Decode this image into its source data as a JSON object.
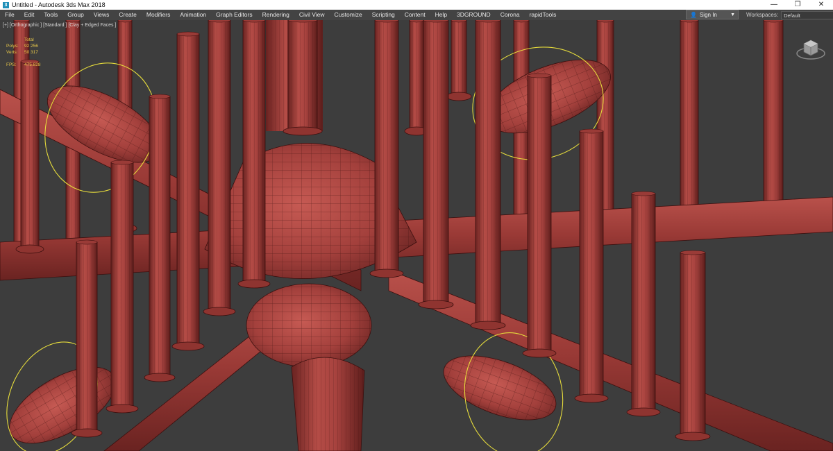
{
  "window": {
    "title": "Untitled - Autodesk 3ds Max 2018",
    "controls": [
      "—",
      "❐",
      "✕"
    ]
  },
  "menu": [
    "File",
    "Edit",
    "Tools",
    "Group",
    "Views",
    "Create",
    "Modifiers",
    "Animation",
    "Graph Editors",
    "Rendering",
    "Civil View",
    "Customize",
    "Scripting",
    "Content",
    "Help",
    "3DGROUND",
    "Corona",
    "rapidTools"
  ],
  "signin": {
    "label": "Sign In"
  },
  "workspaces": {
    "label": "Workspaces:",
    "value": "Default"
  },
  "viewport": {
    "label": "[+] [Orthographic ] [Standard ] [Clay + Edged Faces ]",
    "stats": {
      "header": "Total",
      "polys_label": "Polys:",
      "polys": "92 256",
      "verts_label": "Verts:",
      "verts": "50 317",
      "fps_label": "FPS:",
      "fps": "475.828"
    }
  },
  "colors": {
    "clay": "#a8433f",
    "clay_dark": "#6e2623",
    "wire": "#3b0f0e",
    "selection": "#e6dc3c",
    "viewport_bg": "#3d3d3d"
  },
  "icons": {
    "app": "3ds-max-icon",
    "viewcube": "viewcube-icon",
    "user": "user-icon"
  }
}
